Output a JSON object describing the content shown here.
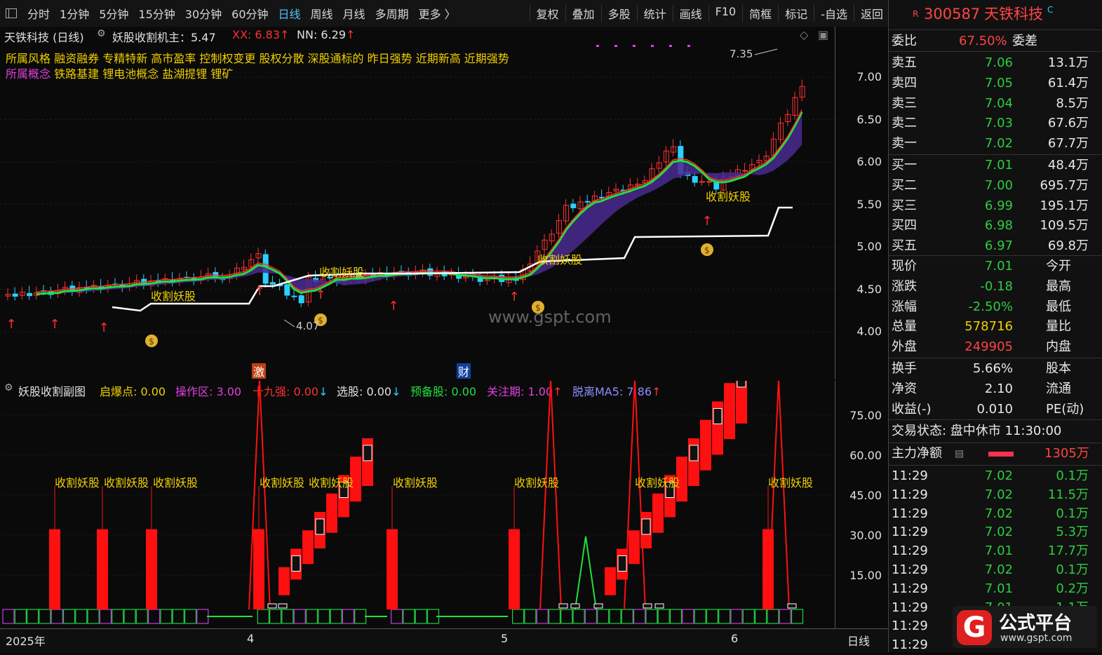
{
  "toolbar": {
    "periods": [
      "分时",
      "1分钟",
      "5分钟",
      "15分钟",
      "30分钟",
      "60分钟",
      "日线",
      "周线",
      "月线",
      "多周期",
      "更多 〉"
    ],
    "active": "日线",
    "tools": [
      "复权",
      "叠加",
      "多股",
      "统计",
      "画线",
      "F10",
      "简框",
      "标记",
      "-自选",
      "返回"
    ]
  },
  "main": {
    "title": "天铁科技 (日线)",
    "indicator": "妖股收割机主：5.47",
    "xx": "XX: 6.83",
    "nn": "NN: 6.29",
    "concept_line1_label": "所属风格",
    "concept_line1": "融资融券 专精特新 高市盈率 控制权变更 股权分散 深股通标的 昨日强势 近期新高 近期强势",
    "concept_line2_label": "所属概念",
    "concept_line2": "铁路基建 锂电池概念 盐湖提锂 锂矿",
    "price_ticks": [
      "7.00",
      "6.50",
      "6.00",
      "5.50",
      "5.00",
      "4.50",
      "4.00"
    ],
    "high_note": "7.35",
    "low_note": "4.07",
    "watermark": "www.gspt.com",
    "signal_label": "收割妖股",
    "marker_ji": "激",
    "marker_cai": "财",
    "colors": {
      "up": "#ff3030",
      "down": "#2ad0ff",
      "yellow": "#f0d000",
      "white": "#ffffff",
      "green": "#20e040",
      "purple": "#5030a0"
    }
  },
  "sub": {
    "title": "妖股收割副图",
    "qibao": "启爆点: 0.00",
    "caozuo": "操作区: 3.00",
    "shijiu": "十九强: 0.00",
    "xuangu": "选股: 0.00",
    "yubei": "预备股: 0.00",
    "guanzhu": "关注期: 1.00",
    "tuoli": "脱离MA5: 7.86",
    "ticks": [
      "75.00",
      "60.00",
      "45.00",
      "30.00",
      "15.00"
    ],
    "signal_label": "收割妖股"
  },
  "dates": {
    "year": "2025年",
    "m4": "4",
    "m5": "5",
    "m6": "6",
    "period": "日线"
  },
  "quote": {
    "code": "300587",
    "name": "天铁科技",
    "weibi_label": "委比",
    "weibi": "67.50%",
    "weicha_label": "委差",
    "sells": [
      {
        "label": "卖五",
        "price": "7.06",
        "vol": "13.1万"
      },
      {
        "label": "卖四",
        "price": "7.05",
        "vol": "61.4万"
      },
      {
        "label": "卖三",
        "price": "7.04",
        "vol": "8.5万"
      },
      {
        "label": "卖二",
        "price": "7.03",
        "vol": "67.6万"
      },
      {
        "label": "卖一",
        "price": "7.02",
        "vol": "67.7万"
      }
    ],
    "buys": [
      {
        "label": "买一",
        "price": "7.01",
        "vol": "48.4万"
      },
      {
        "label": "买二",
        "price": "7.00",
        "vol": "695.7万"
      },
      {
        "label": "买三",
        "price": "6.99",
        "vol": "195.1万"
      },
      {
        "label": "买四",
        "price": "6.98",
        "vol": "109.5万"
      },
      {
        "label": "买五",
        "price": "6.97",
        "vol": "69.8万"
      }
    ],
    "stats": [
      {
        "l": "现价",
        "v": "7.01",
        "r": "今开",
        "c": "green"
      },
      {
        "l": "涨跌",
        "v": "-0.18",
        "r": "最高",
        "c": "green"
      },
      {
        "l": "涨幅",
        "v": "-2.50%",
        "r": "最低",
        "c": "green"
      },
      {
        "l": "总量",
        "v": "578716",
        "r": "量比",
        "c": "yellow"
      },
      {
        "l": "外盘",
        "v": "249905",
        "r": "内盘",
        "c": "red"
      }
    ],
    "stats2": [
      {
        "l": "换手",
        "v": "5.66%",
        "r": "股本"
      },
      {
        "l": "净资",
        "v": "2.10",
        "r": "流通"
      },
      {
        "l": "收益(-)",
        "v": "0.010",
        "r": "PE(动)"
      }
    ],
    "status": "交易状态: 盘中休市 11:30:00",
    "zhuli_label": "主力净额",
    "zhuli": "1305万",
    "ticks": [
      {
        "t": "11:29",
        "p": "7.02",
        "v": "0.1万"
      },
      {
        "t": "11:29",
        "p": "7.02",
        "v": "11.5万"
      },
      {
        "t": "11:29",
        "p": "7.02",
        "v": "0.1万"
      },
      {
        "t": "11:29",
        "p": "7.02",
        "v": "5.3万"
      },
      {
        "t": "11:29",
        "p": "7.01",
        "v": "17.7万"
      },
      {
        "t": "11:29",
        "p": "7.02",
        "v": "0.1万"
      },
      {
        "t": "11:29",
        "p": "7.01",
        "v": "0.2万"
      },
      {
        "t": "11:29",
        "p": "7.01",
        "v": "1.1万"
      },
      {
        "t": "11:29",
        "p": "",
        "v": ""
      },
      {
        "t": "11:29",
        "p": "",
        "v": ""
      }
    ],
    "logo_text": "公式平台",
    "logo_url": "www.gspt.com"
  }
}
